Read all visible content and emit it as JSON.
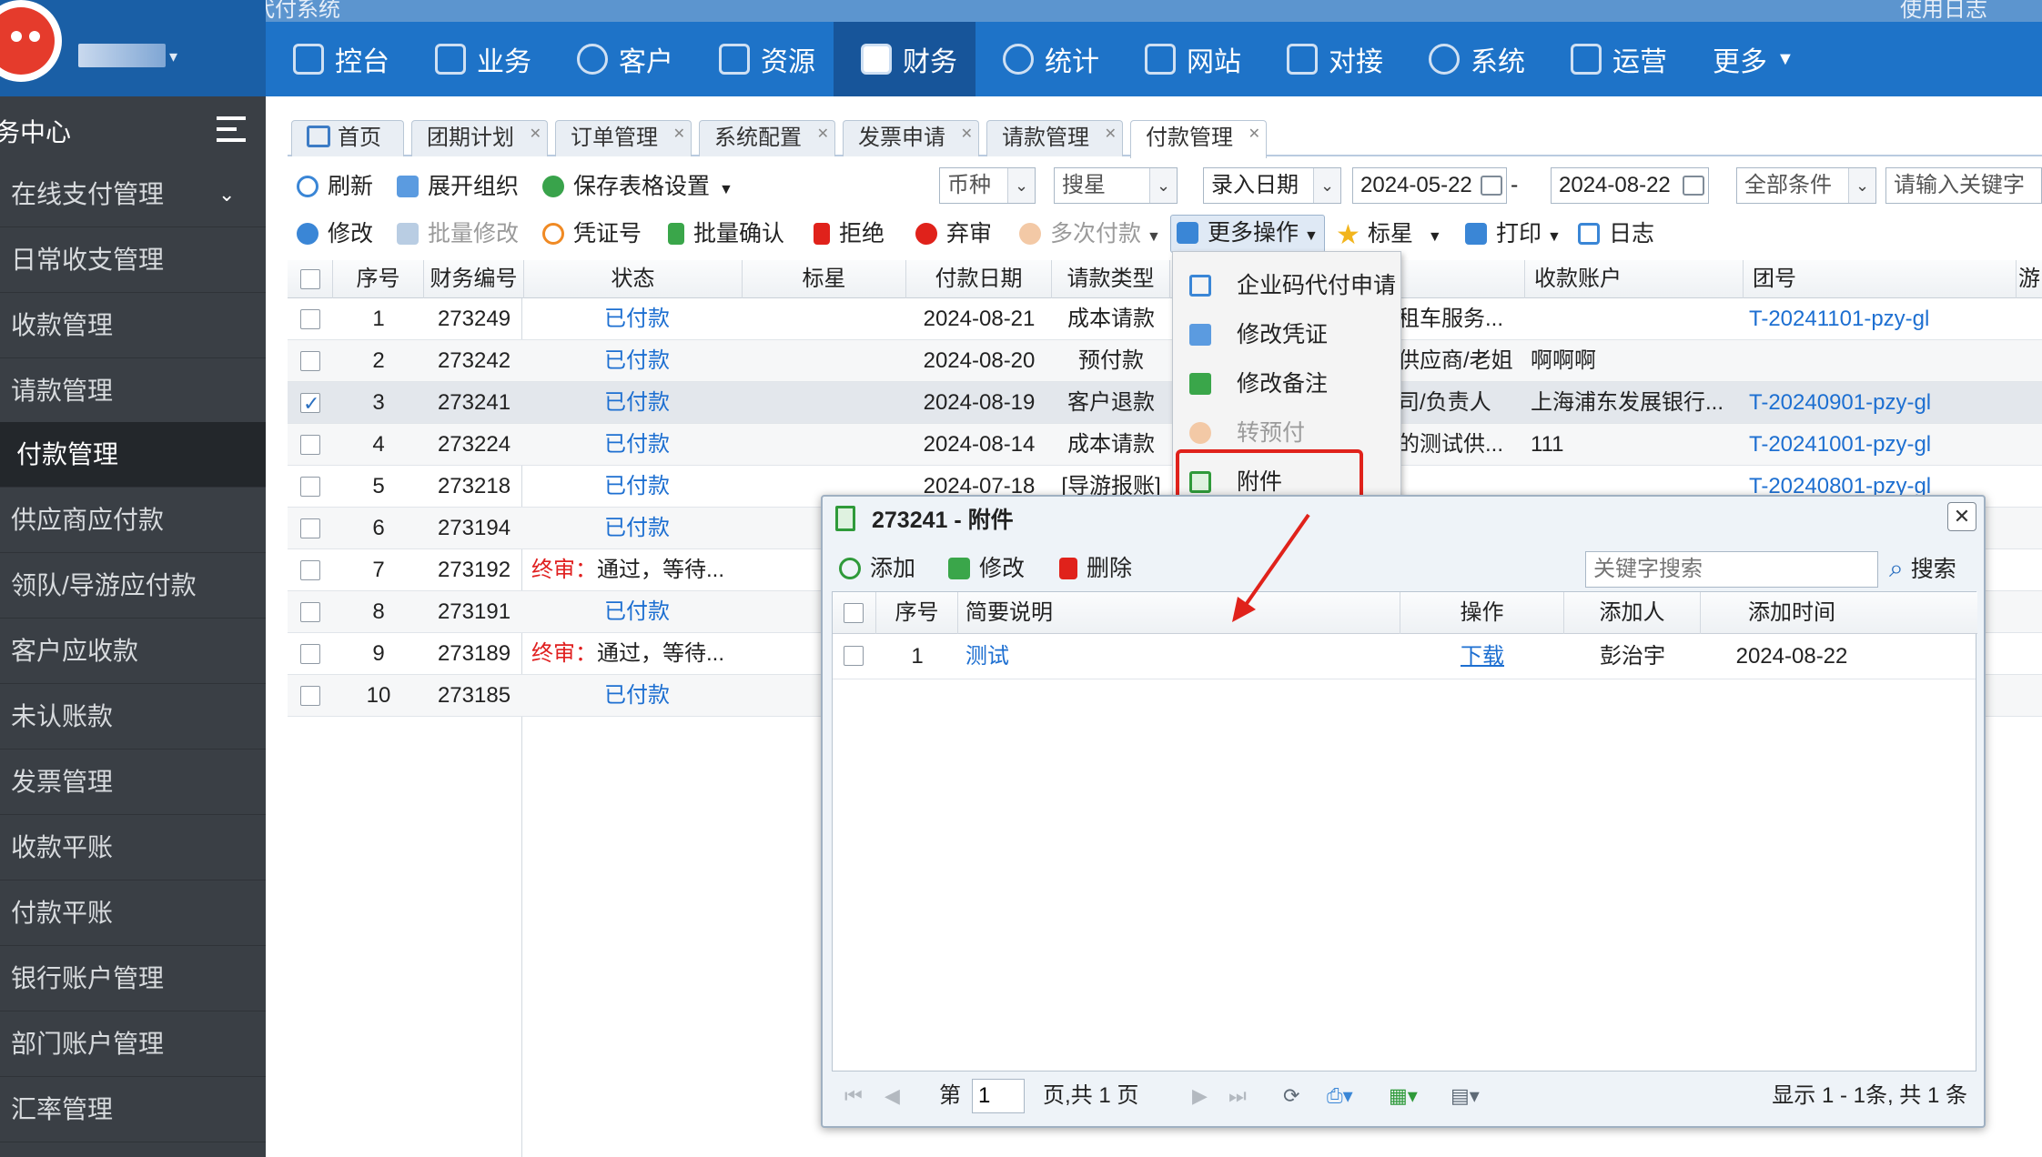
{
  "header": {
    "system_title": "尚天下导游企业码代付系统",
    "top_right": "使用日志",
    "username": "****"
  },
  "nav": {
    "items": [
      {
        "label": "控台",
        "icon": "grid-icon"
      },
      {
        "label": "业务",
        "icon": "cube-icon"
      },
      {
        "label": "客户",
        "icon": "person-icon"
      },
      {
        "label": "资源",
        "icon": "printer-icon"
      },
      {
        "label": "财务",
        "icon": "wallet-icon"
      },
      {
        "label": "统计",
        "icon": "gauge-icon"
      },
      {
        "label": "网站",
        "icon": "grid-icon"
      },
      {
        "label": "对接",
        "icon": "link-icon"
      },
      {
        "label": "系统",
        "icon": "gear-icon"
      },
      {
        "label": "运营",
        "icon": "monitor-icon"
      },
      {
        "label": "更多",
        "icon": "caret-down-icon"
      }
    ],
    "active": "财务"
  },
  "sidebar": {
    "title": "务中心",
    "items": [
      {
        "label": "在线支付管理",
        "has_chevron": true
      },
      {
        "label": "日常收支管理"
      },
      {
        "label": "收款管理"
      },
      {
        "label": "请款管理"
      },
      {
        "label": "付款管理",
        "active": true
      },
      {
        "label": "供应商应付款"
      },
      {
        "label": "领队/导游应付款"
      },
      {
        "label": "客户应收款"
      },
      {
        "label": "未认账款"
      },
      {
        "label": "发票管理"
      },
      {
        "label": "收款平账"
      },
      {
        "label": "付款平账"
      },
      {
        "label": "银行账户管理"
      },
      {
        "label": "部门账户管理"
      },
      {
        "label": "汇率管理"
      }
    ]
  },
  "tabs": [
    {
      "label": "首页",
      "home": true
    },
    {
      "label": "团期计划"
    },
    {
      "label": "订单管理"
    },
    {
      "label": "系统配置"
    },
    {
      "label": "发票申请"
    },
    {
      "label": "请款管理"
    },
    {
      "label": "付款管理",
      "active": true
    }
  ],
  "toolbar1": {
    "refresh": "刷新",
    "expand_org": "展开组织",
    "save_grid": "保存表格设置",
    "currency_placeholder": "币种",
    "search_star": "搜星",
    "date_type": "录入日期",
    "date_from": "2024-05-22",
    "date_to": "2024-08-22",
    "date_sep": "-",
    "all_conditions": "全部条件",
    "keyword_placeholder": "请输入关键字"
  },
  "toolbar2": {
    "edit": "修改",
    "batch_edit": "批量修改",
    "voucher_no": "凭证号",
    "batch_confirm": "批量确认",
    "reject": "拒绝",
    "discard": "弃审",
    "multi_pay": "多次付款",
    "more_ops": "更多操作",
    "star": "标星",
    "print": "打印",
    "log": "日志"
  },
  "grid": {
    "columns": [
      "序号",
      "财务编号",
      "状态",
      "标星",
      "付款日期",
      "请款类型",
      "",
      "收款账户",
      "团号",
      "游"
    ],
    "rows": [
      {
        "seq": "1",
        "no": "273249",
        "status": "已付款",
        "status_prefix": "",
        "date": "2024-08-21",
        "type": "成本请款",
        "party": "租车服务...",
        "account": "",
        "tour": "T-20241101-pzy-gl",
        "checked": false
      },
      {
        "seq": "2",
        "no": "273242",
        "status": "已付款",
        "status_prefix": "",
        "date": "2024-08-20",
        "type": "预付款",
        "party": "供应商/老姐",
        "account": "啊啊啊",
        "tour": "",
        "checked": false
      },
      {
        "seq": "3",
        "no": "273241",
        "status": "已付款",
        "status_prefix": "",
        "date": "2024-08-19",
        "type": "客户退款",
        "party": "司/负责人",
        "account": "上海浦东发展银行...",
        "tour": "T-20240901-pzy-gl",
        "checked": true
      },
      {
        "seq": "4",
        "no": "273224",
        "status": "已付款",
        "status_prefix": "",
        "date": "2024-08-14",
        "type": "成本请款",
        "party": "的测试供...",
        "account": "111",
        "tour": "T-20241001-pzy-gl",
        "checked": false
      },
      {
        "seq": "5",
        "no": "273218",
        "status": "已付款",
        "status_prefix": "",
        "date": "2024-07-18",
        "type": "[导游报账]",
        "party": "",
        "account": "",
        "tour": "T-20240801-pzy-gl",
        "checked": false
      },
      {
        "seq": "6",
        "no": "273194",
        "status": "已付款",
        "status_prefix": "",
        "date": "",
        "type": "",
        "party": "",
        "account": "",
        "tour": "",
        "checked": false
      },
      {
        "seq": "7",
        "no": "273192",
        "status": "通过，等待...",
        "status_prefix": "终审：",
        "date": "",
        "type": "",
        "party": "",
        "account": "",
        "tour": "",
        "checked": false
      },
      {
        "seq": "8",
        "no": "273191",
        "status": "已付款",
        "status_prefix": "",
        "date": "",
        "type": "",
        "party": "",
        "account": "",
        "tour": "",
        "checked": false
      },
      {
        "seq": "9",
        "no": "273189",
        "status": "通过，等待...",
        "status_prefix": "终审：",
        "date": "",
        "type": "",
        "party": "",
        "account": "",
        "tour": "",
        "checked": false
      },
      {
        "seq": "10",
        "no": "273185",
        "status": "已付款",
        "status_prefix": "",
        "date": "",
        "type": "",
        "party": "",
        "account": "",
        "tour": "",
        "checked": false
      }
    ]
  },
  "dropdown": {
    "items": [
      {
        "label": "企业码代付申请",
        "icon": "upload-icon",
        "disabled": false
      },
      {
        "label": "修改凭证",
        "icon": "edit-doc-icon",
        "disabled": false
      },
      {
        "label": "修改备注",
        "icon": "note-icon",
        "disabled": false
      },
      {
        "label": "转预付",
        "icon": "coin-icon",
        "disabled": true
      },
      {
        "label": "附件",
        "icon": "attachment-icon",
        "disabled": false
      }
    ]
  },
  "dialog": {
    "title": "273241 - 附件",
    "add": "添加",
    "edit": "修改",
    "delete": "删除",
    "search_placeholder": "关键字搜索",
    "search": "搜索",
    "columns": [
      "序号",
      "简要说明",
      "操作",
      "添加人",
      "添加时间"
    ],
    "rows": [
      {
        "seq": "1",
        "desc": "测试",
        "action": "下载",
        "by": "彭治宇",
        "time": "2024-08-22"
      }
    ],
    "pager": {
      "page_label": "第",
      "page": "1",
      "page_total": "页,共 1 页",
      "summary": "显示 1 - 1条, 共 1 条"
    }
  },
  "colors": {
    "header_blue": "#1e73c8",
    "sidebar_dark": "#3a3f45",
    "link_blue": "#1d6fd1",
    "highlight_red": "#e0221b"
  }
}
